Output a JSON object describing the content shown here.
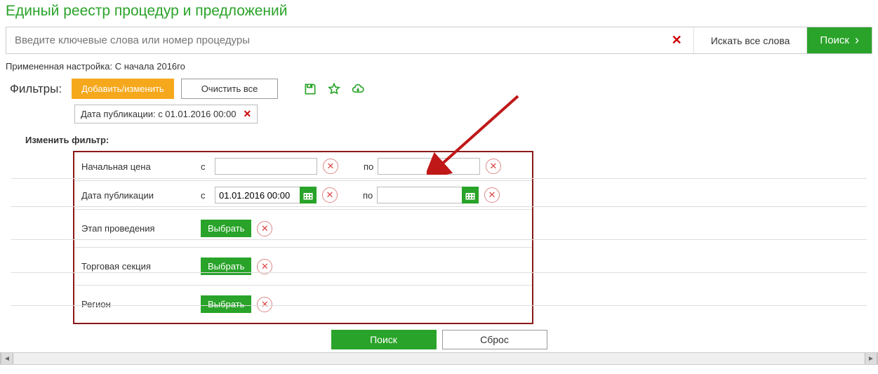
{
  "title": "Единый реестр процедур и предложений",
  "search": {
    "placeholder": "Введите ключевые слова или номер процедуры",
    "mode_label": "Искать все слова",
    "button": "Поиск"
  },
  "applied": {
    "prefix": "Примененная настройка:",
    "value": "С начала 2016го"
  },
  "filters": {
    "label": "Фильтры:",
    "add_edit": "Добавить/изменить",
    "clear_all": "Очистить все"
  },
  "chip": {
    "label": "Дата публикации: с 01.01.2016 00:00"
  },
  "edit_filter_heading": "Изменить фильтр:",
  "rows": {
    "price": {
      "label": "Начальная цена",
      "from": "с",
      "to": "по"
    },
    "pub_date": {
      "label": "Дата публикации",
      "from": "с",
      "to": "по",
      "from_value": "01.01.2016 00:00"
    },
    "stage": {
      "label": "Этап проведения",
      "select": "Выбрать"
    },
    "section": {
      "label": "Торговая секция",
      "select": "Выбрать"
    },
    "region": {
      "label": "Регион",
      "select": "Выбрать"
    }
  },
  "bottom": {
    "search": "Поиск",
    "reset": "Сброс"
  }
}
